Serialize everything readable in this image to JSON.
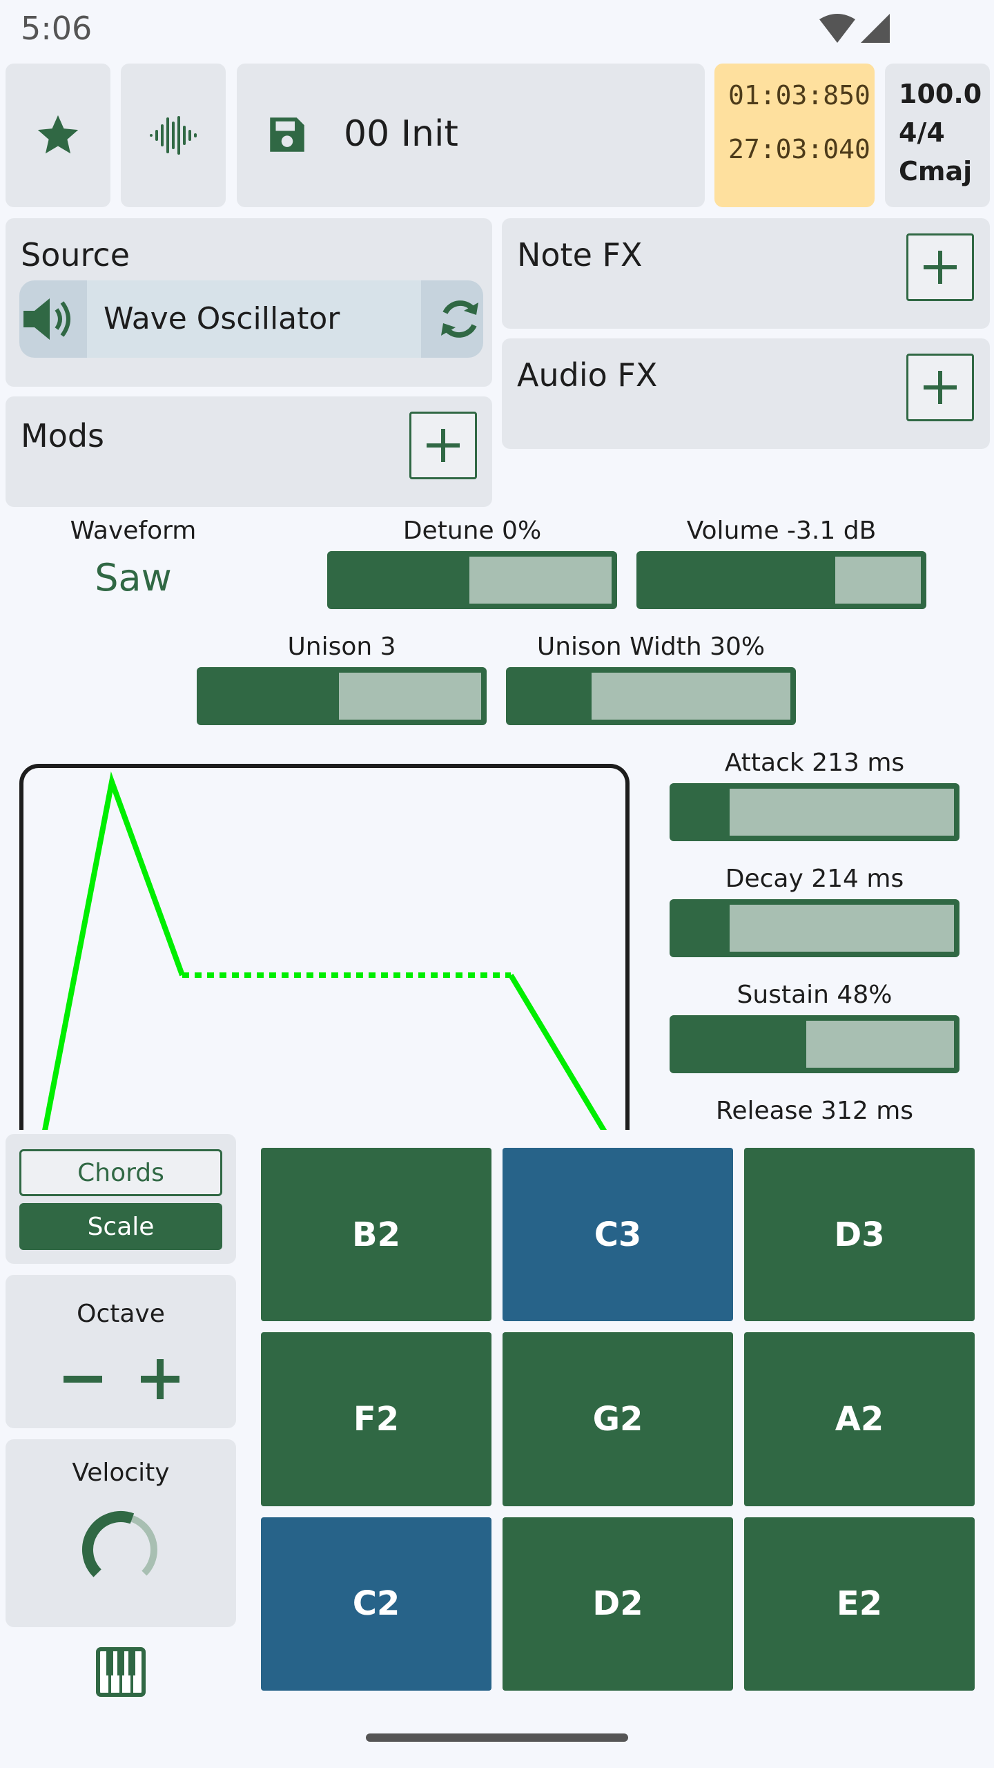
{
  "status": {
    "time": "5:06"
  },
  "header": {
    "preset_name": "00 Init",
    "position_bars": "01:03:850",
    "position_time": "27:03:040",
    "tempo": "100.0",
    "time_signature": "4/4",
    "key": "Cmaj"
  },
  "source": {
    "title": "Source",
    "instrument": "Wave Oscillator"
  },
  "note_fx": {
    "title": "Note FX"
  },
  "audio_fx": {
    "title": "Audio FX"
  },
  "mods": {
    "title": "Mods"
  },
  "oscillator": {
    "waveform_label": "Waveform",
    "waveform_value": "Saw",
    "detune_label": "Detune 0%",
    "detune_level": 0.5,
    "volume_label": "Volume -3.1 dB",
    "volume_level": 0.7,
    "unison_label": "Unison 3",
    "unison_level": 0.5,
    "unison_width_label": "Unison Width 30%",
    "unison_width_level": 0.3
  },
  "envelope": {
    "attack_label": "Attack 213 ms",
    "attack_level": 0.21,
    "decay_label": "Decay 214 ms",
    "decay_level": 0.21,
    "sustain_label": "Sustain 48%",
    "sustain_level": 0.48,
    "release_label": "Release 312 ms"
  },
  "keyboard_mode": {
    "chords_label": "Chords",
    "scale_label": "Scale",
    "selected": "Scale"
  },
  "octave": {
    "label": "Octave"
  },
  "velocity": {
    "label": "Velocity",
    "level": 0.65
  },
  "pads": [
    {
      "note": "B2",
      "color": "#306844"
    },
    {
      "note": "C3",
      "color": "#276389"
    },
    {
      "note": "D3",
      "color": "#306844"
    },
    {
      "note": "F2",
      "color": "#306844"
    },
    {
      "note": "G2",
      "color": "#306844"
    },
    {
      "note": "A2",
      "color": "#306844"
    },
    {
      "note": "C2",
      "color": "#276389"
    },
    {
      "note": "D2",
      "color": "#306844"
    },
    {
      "note": "E2",
      "color": "#306844"
    }
  ],
  "colors": {
    "accent": "#306844",
    "root_pad": "#276389",
    "envelope_line": "#00ee00",
    "transport_bg": "#fee09e"
  }
}
